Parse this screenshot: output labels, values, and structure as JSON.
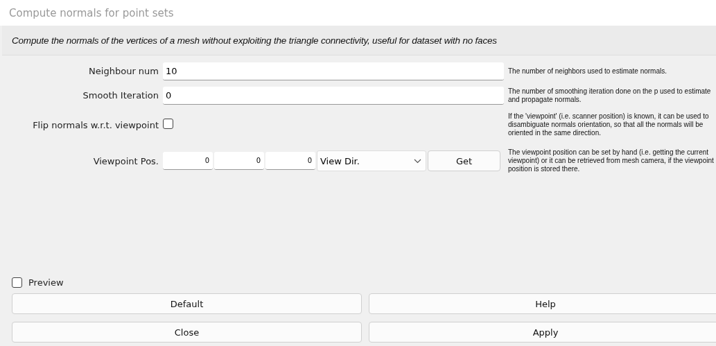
{
  "window": {
    "title": "Compute normals for point sets"
  },
  "description": "Compute the normals of the vertices of a mesh without exploiting the triangle connectivity, useful for dataset with no faces",
  "parameters": [
    {
      "kind": "number",
      "label": "Neighbour num",
      "value": "10",
      "help": "The number of neighbors used to estimate normals."
    },
    {
      "kind": "number",
      "label": "Smooth Iteration",
      "value": "0",
      "help": "The number of smoothing iteration done on the p used to estimate and propagate normals."
    },
    {
      "kind": "checkbox",
      "label": "Flip normals w.r.t. viewpoint",
      "checked": false,
      "help": "If the 'viewpoint' (i.e. scanner position) is known, it can be used to disambiguate normals orientation, so that all the normals will be oriented in the same direction."
    },
    {
      "kind": "point",
      "label": "Viewpoint Pos.",
      "values": [
        "0",
        "0",
        "0"
      ],
      "dropdown": "View Dir.",
      "button": "Get",
      "help": "The viewpoint position can be set by hand (i.e. getting the current viewpoint) or it can be retrieved from mesh camera, if the viewpoint position is stored there."
    }
  ],
  "preview": {
    "label": "Preview",
    "checked": false
  },
  "buttons": [
    "Default",
    "Help",
    "Close",
    "Apply"
  ]
}
